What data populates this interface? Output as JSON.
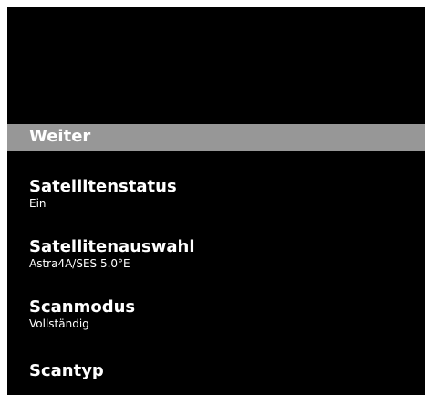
{
  "menu": {
    "highlighted_label": "Weiter",
    "items": [
      {
        "label": "Satellitenstatus",
        "value": "Ein"
      },
      {
        "label": "Satellitenauswahl",
        "value": "Astra4A/SES 5.0°E"
      },
      {
        "label": "Scanmodus",
        "value": "Vollständig"
      },
      {
        "label": "Scantyp"
      }
    ]
  },
  "colors": {
    "background": "#000000",
    "highlight": "#979797",
    "text": "#ffffff"
  }
}
